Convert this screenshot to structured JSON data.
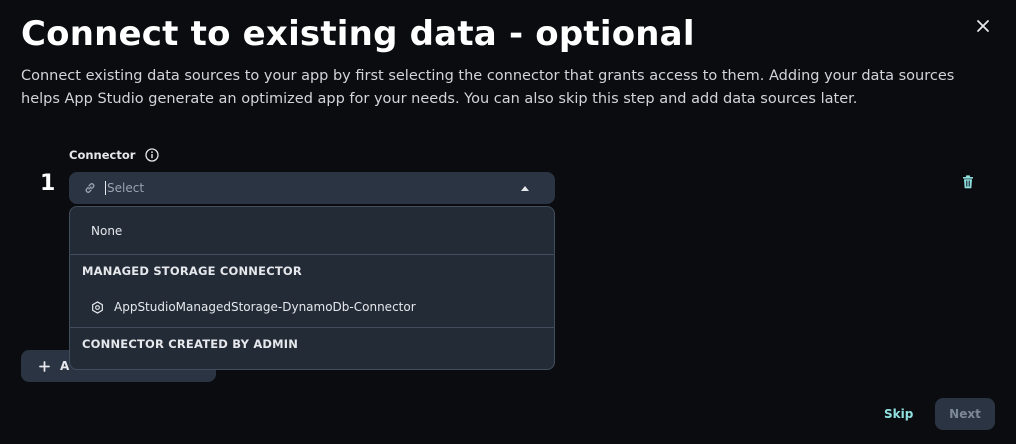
{
  "header": {
    "title": "Connect to existing data - optional",
    "description": "Connect existing data sources to your app by first selecting the connector that grants access to them. Adding your data sources helps App Studio generate an optimized app for your needs. You can also skip this step and add data sources later."
  },
  "connector": {
    "label": "Connector",
    "row_number": "1",
    "select_placeholder": "Select",
    "icons": {
      "link": "link-icon",
      "info": "info-icon",
      "caret": "caret-up-icon",
      "delete": "trash-icon"
    }
  },
  "dropdown": {
    "none_option": "None",
    "groups": [
      {
        "header": "MANAGED STORAGE CONNECTOR",
        "items": [
          "AppStudioManagedStorage-DynamoDb-Connector"
        ]
      },
      {
        "header": "CONNECTOR CREATED BY ADMIN",
        "items": []
      }
    ]
  },
  "add_button": {
    "label": "A"
  },
  "footer": {
    "skip_label": "Skip",
    "next_label": "Next"
  },
  "colors": {
    "accent": "#8fe0e0",
    "background": "#0b0c10",
    "surface": "#2b3443"
  }
}
